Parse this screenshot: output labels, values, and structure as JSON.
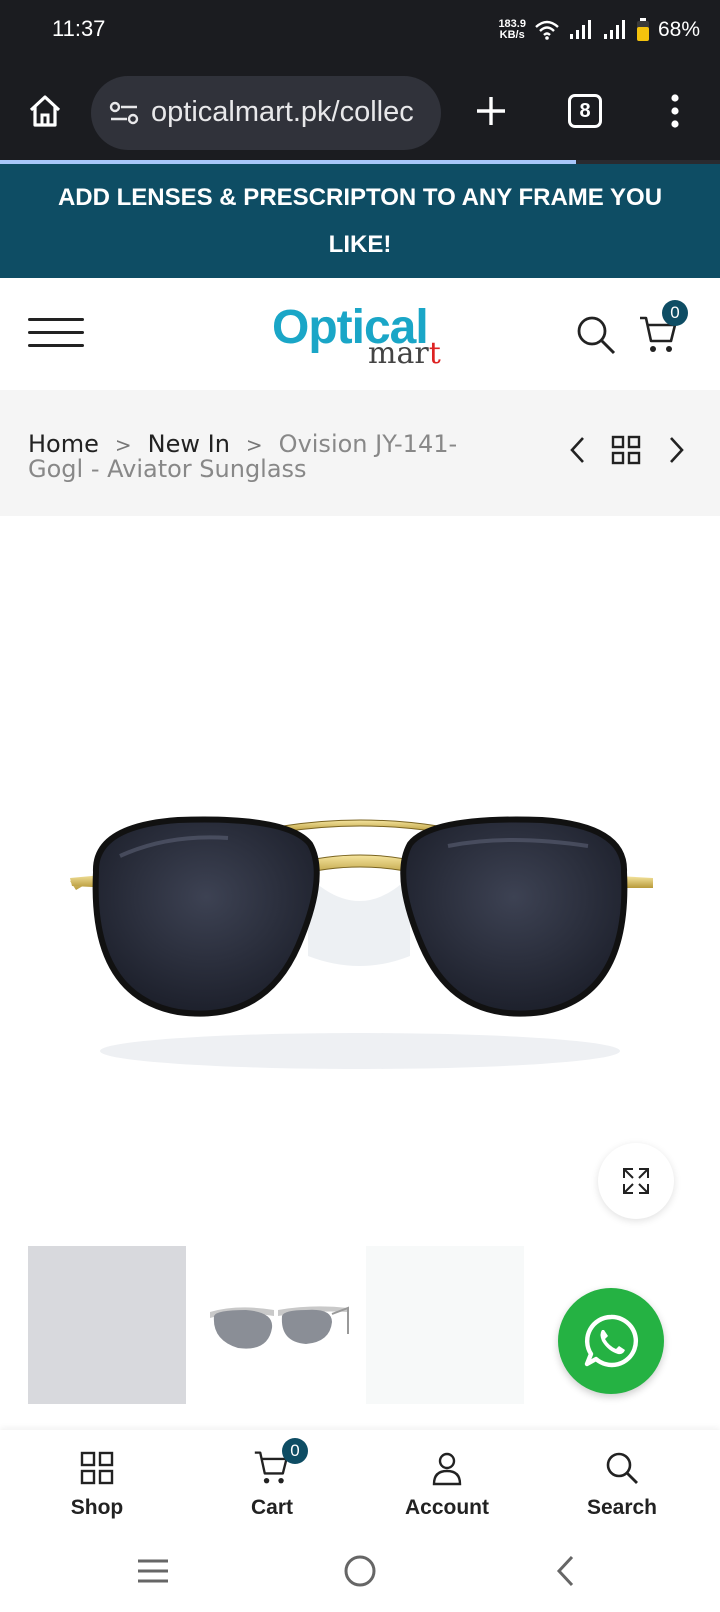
{
  "status_bar": {
    "time": "11:37",
    "net_speed_value": "183.9",
    "net_speed_unit": "KB/s",
    "battery": "68%"
  },
  "browser": {
    "url": "opticalmart.pk/collec",
    "tab_count": "8",
    "load_progress": 0.8
  },
  "announcement": "ADD LENSES & PRESCRIPTON TO ANY FRAME YOU LIKE!",
  "header": {
    "logo_optical": "Optical",
    "logo_mar": "mar",
    "logo_t": "t",
    "cart_count": "0"
  },
  "breadcrumb": {
    "home": "Home",
    "sep": ">",
    "category": "New In",
    "current": "Ovision JY-141-Gogl - Aviator Sunglass"
  },
  "bottom_nav": {
    "shop": "Shop",
    "cart": "Cart",
    "cart_count": "0",
    "account": "Account",
    "search": "Search"
  },
  "colors": {
    "brand": "#0e4d64",
    "logo_blue": "#1aa6c7",
    "whatsapp": "#25b243"
  }
}
